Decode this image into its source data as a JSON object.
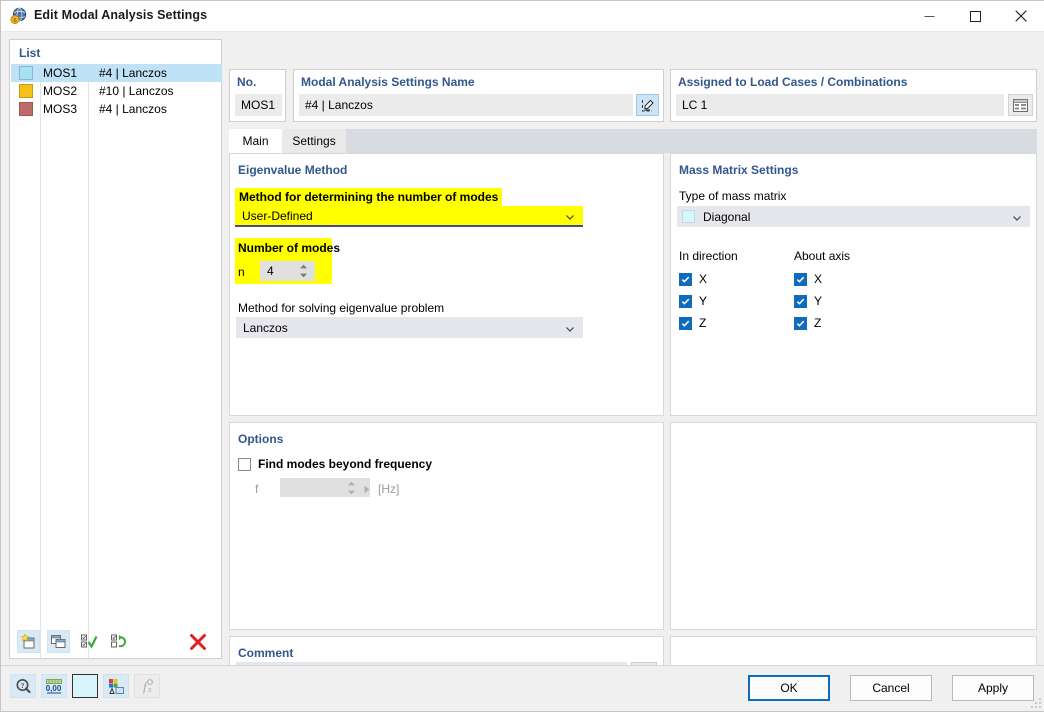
{
  "window": {
    "title": "Edit Modal Analysis Settings",
    "icon": "modal-analysis-icon",
    "minimize": "minimize-icon",
    "maximize": "maximize-icon",
    "close": "close-icon"
  },
  "list": {
    "title": "List",
    "rows": [
      {
        "swatch": "#a6e1f4",
        "id": "MOS1",
        "desc": "#4 | Lanczos",
        "selected": true
      },
      {
        "swatch": "#f5c018",
        "id": "MOS2",
        "desc": "#10 | Lanczos",
        "selected": false
      },
      {
        "swatch": "#bd6b6b",
        "id": "MOS3",
        "desc": "#4 | Lanczos",
        "selected": false
      }
    ],
    "toolbar": {
      "new": "new-item-icon",
      "copy": "copy-item-icon",
      "select_all": "select-all-icon",
      "invert_selection": "invert-selection-icon",
      "delete": "delete-icon"
    }
  },
  "header": {
    "no_label": "No.",
    "no_value": "MOS1",
    "name_label": "Modal Analysis Settings Name",
    "name_value": "#4 | Lanczos",
    "name_edit_icon": "edit-pencil-icon",
    "assigned_label": "Assigned to Load Cases / Combinations",
    "assigned_value": "LC 1",
    "assigned_icon": "table-select-icon"
  },
  "tabs": [
    {
      "label": "Main",
      "active": true
    },
    {
      "label": "Settings",
      "active": false
    }
  ],
  "eigenvalue": {
    "title": "Eigenvalue Method",
    "method_modes_label": "Method for determining the number of modes",
    "method_modes_value": "User-Defined",
    "number_of_modes_label": "Number of modes",
    "n_symbol": "n",
    "n_value": "4",
    "solver_label": "Method for solving eigenvalue problem",
    "solver_value": "Lanczos"
  },
  "mass_matrix": {
    "title": "Mass Matrix Settings",
    "type_label": "Type of mass matrix",
    "type_value": "Diagonal",
    "type_swatch": "#d6f6fb",
    "in_direction_label": "In direction",
    "about_axis_label": "About axis",
    "in_direction": [
      {
        "label": "X",
        "checked": true
      },
      {
        "label": "Y",
        "checked": true
      },
      {
        "label": "Z",
        "checked": true
      }
    ],
    "about_axis": [
      {
        "label": "X",
        "checked": true
      },
      {
        "label": "Y",
        "checked": true
      },
      {
        "label": "Z",
        "checked": true
      }
    ]
  },
  "options": {
    "title": "Options",
    "find_modes_label": "Find modes beyond frequency",
    "find_modes_checked": false,
    "f_symbol": "f",
    "f_value": "",
    "f_unit": "[Hz]"
  },
  "comment": {
    "title": "Comment",
    "value": "",
    "button_icon": "comment-library-icon"
  },
  "footer": {
    "tools": [
      {
        "name": "info-icon",
        "disabled": false
      },
      {
        "name": "decimal-places-icon",
        "disabled": false
      },
      {
        "name": "color-swatch-icon",
        "disabled": false
      },
      {
        "name": "display-properties-icon",
        "disabled": false
      },
      {
        "name": "formula-icon",
        "disabled": true
      }
    ],
    "buttons": {
      "ok": "OK",
      "cancel": "Cancel",
      "apply": "Apply"
    }
  },
  "colors": {
    "accent": "#0f6cbd",
    "header_text": "#31578d",
    "highlight": "#ffff00",
    "selection": "#bfe2f7"
  }
}
